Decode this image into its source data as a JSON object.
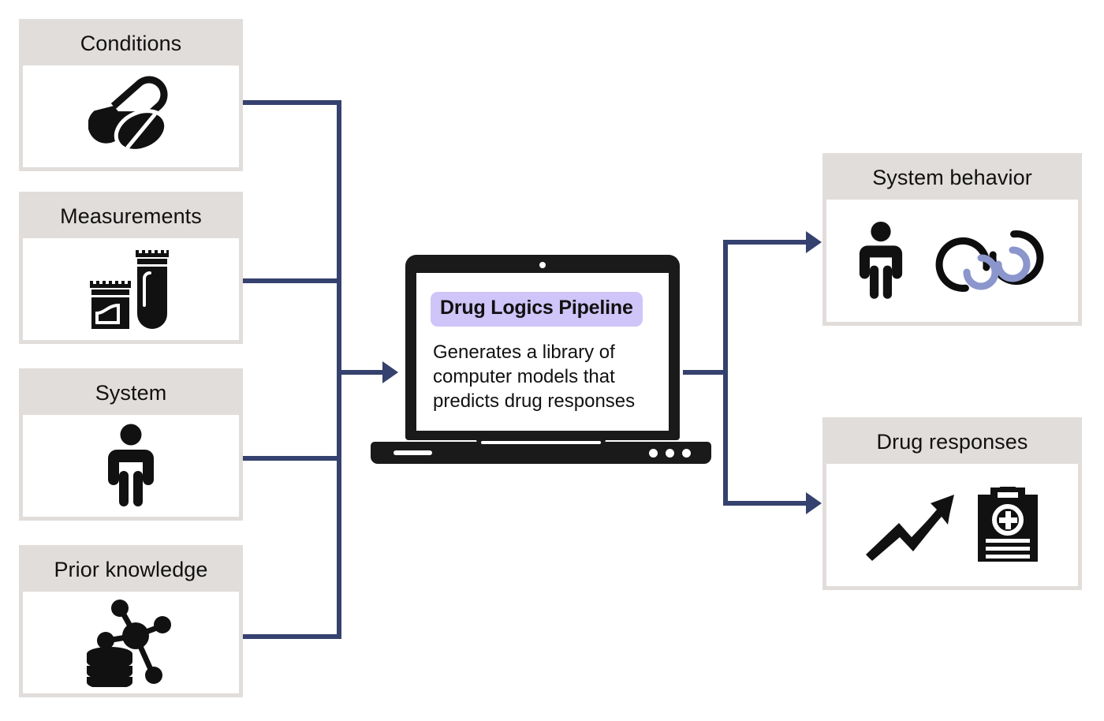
{
  "diagram": {
    "title": "Drug Logics Pipeline overview diagram",
    "accent_color": "#35416e",
    "header_color": "#e1ddda",
    "highlight_color": "#cfc5f8",
    "icon_color": "#111111",
    "secondary_icon_color": "#8b96cc"
  },
  "inputs": [
    {
      "id": "conditions",
      "label": "Conditions",
      "icon": "pills-capsule-tablet-icon"
    },
    {
      "id": "measurements",
      "label": "Measurements",
      "icon": "specimen-jar-and-test-tube-icon"
    },
    {
      "id": "system",
      "label": "System",
      "icon": "person-figure-icon"
    },
    {
      "id": "prior-knowledge",
      "label": "Prior knowledge",
      "icon": "database-network-graph-icon"
    }
  ],
  "pipeline": {
    "screen_title": "Drug Logics Pipeline",
    "screen_body": "Generates a library of computer models that predicts drug responses",
    "device_icon": "laptop-icon",
    "camera_icon": "webcam-dot-icon",
    "trackpad_icon": "trackpad-icon"
  },
  "outputs": [
    {
      "id": "system-behavior",
      "label": "System behavior",
      "icon": "person-and-feedback-loops-icon"
    },
    {
      "id": "drug-responses",
      "label": "Drug responses",
      "icon": "rising-arrow-and-medical-clipboard-icon"
    }
  ],
  "connectors": {
    "input_bus_label": "inputs-to-pipeline-connector",
    "output_bus_label": "pipeline-to-outputs-connector"
  }
}
